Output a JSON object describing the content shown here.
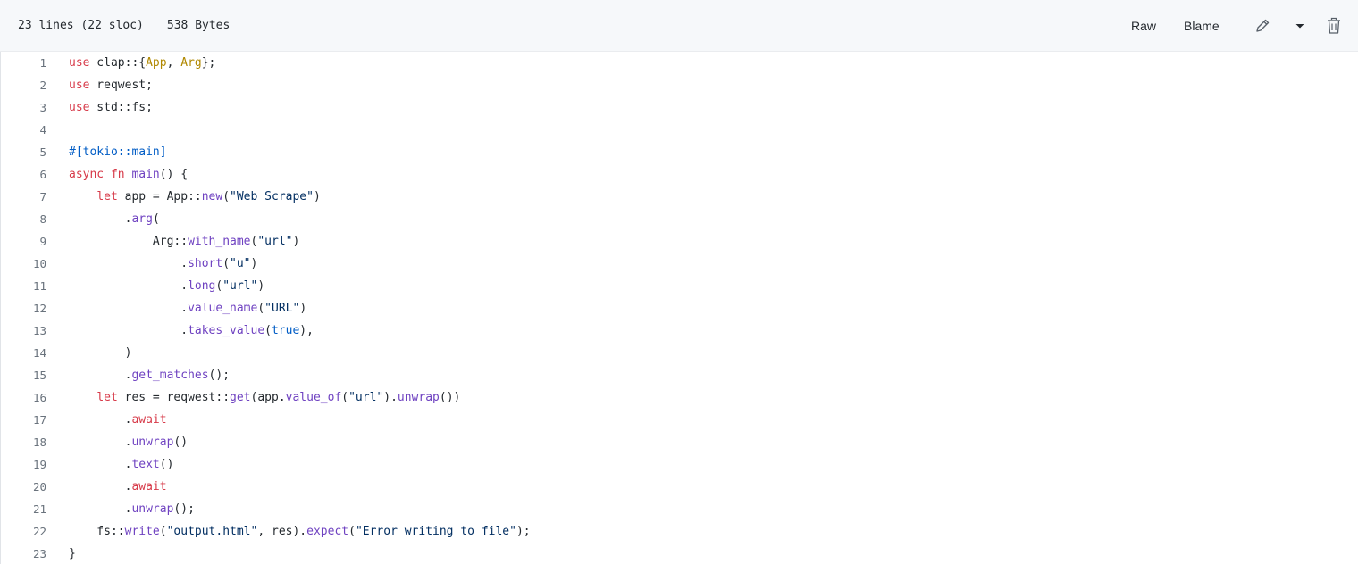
{
  "file_header": {
    "lines_text": "23 lines (22 sloc)",
    "size_text": "538 Bytes",
    "raw_label": "Raw",
    "blame_label": "Blame"
  },
  "icons": {
    "edit": "pencil-icon",
    "dropdown": "triangle-down-icon",
    "delete": "trash-icon"
  },
  "colors": {
    "keyword": "#d73a49",
    "string": "#032f62",
    "attribute": "#005cc5",
    "function": "#6f42c1",
    "type": "#b08800",
    "text": "#24292e",
    "line_number": "#6a737d"
  },
  "code_lines": [
    {
      "n": "1",
      "tokens": [
        {
          "t": "use",
          "c": "kw"
        },
        {
          "t": " clap::{",
          "c": "plain"
        },
        {
          "t": "App",
          "c": "typ"
        },
        {
          "t": ", ",
          "c": "plain"
        },
        {
          "t": "Arg",
          "c": "typ"
        },
        {
          "t": "};",
          "c": "plain"
        }
      ]
    },
    {
      "n": "2",
      "tokens": [
        {
          "t": "use",
          "c": "kw"
        },
        {
          "t": " reqwest;",
          "c": "plain"
        }
      ]
    },
    {
      "n": "3",
      "tokens": [
        {
          "t": "use",
          "c": "kw"
        },
        {
          "t": " std::fs;",
          "c": "plain"
        }
      ]
    },
    {
      "n": "4",
      "tokens": []
    },
    {
      "n": "5",
      "tokens": [
        {
          "t": "#[tokio::main]",
          "c": "attr"
        }
      ]
    },
    {
      "n": "6",
      "tokens": [
        {
          "t": "async",
          "c": "kw"
        },
        {
          "t": " ",
          "c": "plain"
        },
        {
          "t": "fn",
          "c": "kw"
        },
        {
          "t": " ",
          "c": "plain"
        },
        {
          "t": "main",
          "c": "fn"
        },
        {
          "t": "() {",
          "c": "plain"
        }
      ]
    },
    {
      "n": "7",
      "tokens": [
        {
          "t": "    ",
          "c": "plain"
        },
        {
          "t": "let",
          "c": "kw"
        },
        {
          "t": " app = App::",
          "c": "plain"
        },
        {
          "t": "new",
          "c": "fn"
        },
        {
          "t": "(",
          "c": "plain"
        },
        {
          "t": "\"Web Scrape\"",
          "c": "str"
        },
        {
          "t": ")",
          "c": "plain"
        }
      ]
    },
    {
      "n": "8",
      "tokens": [
        {
          "t": "        .",
          "c": "plain"
        },
        {
          "t": "arg",
          "c": "fn"
        },
        {
          "t": "(",
          "c": "plain"
        }
      ]
    },
    {
      "n": "9",
      "tokens": [
        {
          "t": "            Arg::",
          "c": "plain"
        },
        {
          "t": "with_name",
          "c": "fn"
        },
        {
          "t": "(",
          "c": "plain"
        },
        {
          "t": "\"url\"",
          "c": "str"
        },
        {
          "t": ")",
          "c": "plain"
        }
      ]
    },
    {
      "n": "10",
      "tokens": [
        {
          "t": "                .",
          "c": "plain"
        },
        {
          "t": "short",
          "c": "fn"
        },
        {
          "t": "(",
          "c": "plain"
        },
        {
          "t": "\"u\"",
          "c": "str"
        },
        {
          "t": ")",
          "c": "plain"
        }
      ]
    },
    {
      "n": "11",
      "tokens": [
        {
          "t": "                .",
          "c": "plain"
        },
        {
          "t": "long",
          "c": "fn"
        },
        {
          "t": "(",
          "c": "plain"
        },
        {
          "t": "\"url\"",
          "c": "str"
        },
        {
          "t": ")",
          "c": "plain"
        }
      ]
    },
    {
      "n": "12",
      "tokens": [
        {
          "t": "                .",
          "c": "plain"
        },
        {
          "t": "value_name",
          "c": "fn"
        },
        {
          "t": "(",
          "c": "plain"
        },
        {
          "t": "\"URL\"",
          "c": "str"
        },
        {
          "t": ")",
          "c": "plain"
        }
      ]
    },
    {
      "n": "13",
      "tokens": [
        {
          "t": "                .",
          "c": "plain"
        },
        {
          "t": "takes_value",
          "c": "fn"
        },
        {
          "t": "(",
          "c": "plain"
        },
        {
          "t": "true",
          "c": "attr"
        },
        {
          "t": "),",
          "c": "plain"
        }
      ]
    },
    {
      "n": "14",
      "tokens": [
        {
          "t": "        )",
          "c": "plain"
        }
      ]
    },
    {
      "n": "15",
      "tokens": [
        {
          "t": "        .",
          "c": "plain"
        },
        {
          "t": "get_matches",
          "c": "fn"
        },
        {
          "t": "();",
          "c": "plain"
        }
      ]
    },
    {
      "n": "16",
      "tokens": [
        {
          "t": "    ",
          "c": "plain"
        },
        {
          "t": "let",
          "c": "kw"
        },
        {
          "t": " res = reqwest::",
          "c": "plain"
        },
        {
          "t": "get",
          "c": "fn"
        },
        {
          "t": "(app.",
          "c": "plain"
        },
        {
          "t": "value_of",
          "c": "fn"
        },
        {
          "t": "(",
          "c": "plain"
        },
        {
          "t": "\"url\"",
          "c": "str"
        },
        {
          "t": ").",
          "c": "plain"
        },
        {
          "t": "unwrap",
          "c": "fn"
        },
        {
          "t": "())",
          "c": "plain"
        }
      ]
    },
    {
      "n": "17",
      "tokens": [
        {
          "t": "        .",
          "c": "plain"
        },
        {
          "t": "await",
          "c": "kw"
        }
      ]
    },
    {
      "n": "18",
      "tokens": [
        {
          "t": "        .",
          "c": "plain"
        },
        {
          "t": "unwrap",
          "c": "fn"
        },
        {
          "t": "()",
          "c": "plain"
        }
      ]
    },
    {
      "n": "19",
      "tokens": [
        {
          "t": "        .",
          "c": "plain"
        },
        {
          "t": "text",
          "c": "fn"
        },
        {
          "t": "()",
          "c": "plain"
        }
      ]
    },
    {
      "n": "20",
      "tokens": [
        {
          "t": "        .",
          "c": "plain"
        },
        {
          "t": "await",
          "c": "kw"
        }
      ]
    },
    {
      "n": "21",
      "tokens": [
        {
          "t": "        .",
          "c": "plain"
        },
        {
          "t": "unwrap",
          "c": "fn"
        },
        {
          "t": "();",
          "c": "plain"
        }
      ]
    },
    {
      "n": "22",
      "tokens": [
        {
          "t": "    fs::",
          "c": "plain"
        },
        {
          "t": "write",
          "c": "fn"
        },
        {
          "t": "(",
          "c": "plain"
        },
        {
          "t": "\"output.html\"",
          "c": "str"
        },
        {
          "t": ", res).",
          "c": "plain"
        },
        {
          "t": "expect",
          "c": "fn"
        },
        {
          "t": "(",
          "c": "plain"
        },
        {
          "t": "\"Error writing to file\"",
          "c": "str"
        },
        {
          "t": ");",
          "c": "plain"
        }
      ]
    },
    {
      "n": "23",
      "tokens": [
        {
          "t": "}",
          "c": "plain"
        }
      ]
    }
  ]
}
